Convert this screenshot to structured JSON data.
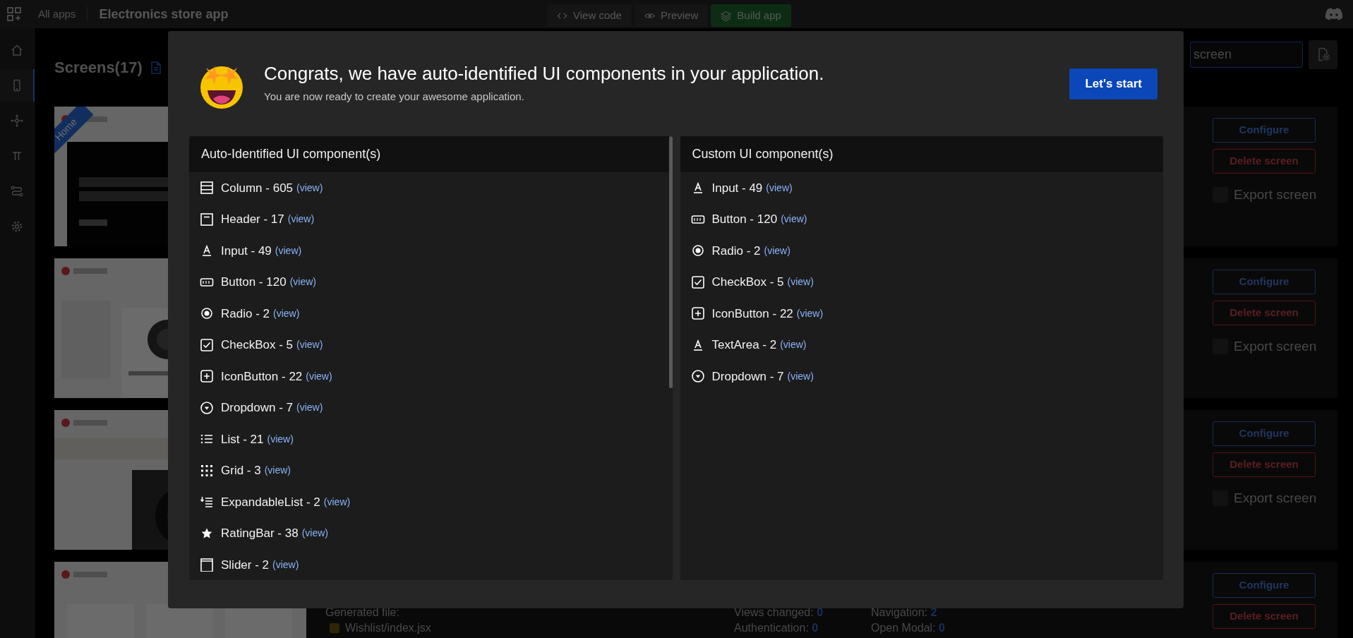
{
  "top_bar": {
    "apps_label": "All apps",
    "title": "Electronics store app",
    "buttons": [
      {
        "kind": "code",
        "label": "View code"
      },
      {
        "kind": "eye",
        "label": "Preview"
      },
      {
        "kind": "build",
        "label": "Build app"
      }
    ]
  },
  "sidebar": {
    "items": [
      {
        "kind": "home",
        "selected": false
      },
      {
        "kind": "phone",
        "selected": true
      },
      {
        "kind": "nodes",
        "selected": false
      },
      {
        "kind": "pi",
        "selected": false
      },
      {
        "kind": "route",
        "selected": false
      },
      {
        "kind": "gear",
        "selected": false
      }
    ]
  },
  "screens": {
    "title": "Screens(17)",
    "search": {
      "placeholder": "screen"
    },
    "cards": [
      {
        "ribbon": "Home",
        "buttons": [
          "Configure",
          "Delete screen"
        ],
        "export": {
          "label": "Export screen",
          "checked": false
        }
      },
      {
        "buttons": [
          "Configure",
          "Delete screen"
        ],
        "export": {
          "label": "Export screen",
          "checked": false
        }
      },
      {
        "buttons": [
          "Configure",
          "Delete screen"
        ],
        "export": {
          "label": "Export screen",
          "checked": false
        }
      },
      {
        "buttons": [
          "Configure",
          "Delete screen"
        ],
        "generated": {
          "label": "Generated file:",
          "files": [
            "Wishlist/index.jsx"
          ]
        },
        "stats": [
          {
            "label": "Views changed:",
            "value": "0"
          },
          {
            "label": "Navigation:",
            "value": "2"
          },
          {
            "label": "Authentication:",
            "value": "0"
          },
          {
            "label": "Open Modal:",
            "value": "0"
          }
        ]
      }
    ]
  },
  "modal": {
    "title": "Congrats, we have auto-identified UI components in your application.",
    "subtitle": "You are now ready to create your awesome application.",
    "start_button": "Let's start",
    "panels": [
      {
        "title": "Auto-Identified UI component(s)",
        "items": [
          {
            "kind": "column",
            "label": "Column - 605",
            "link": "(view)"
          },
          {
            "kind": "header",
            "label": "Header - 17",
            "link": "(view)"
          },
          {
            "kind": "input",
            "label": "Input - 49",
            "link": "(view)"
          },
          {
            "kind": "button",
            "label": "Button - 120",
            "link": "(view)"
          },
          {
            "kind": "radio",
            "label": "Radio - 2",
            "link": "(view)"
          },
          {
            "kind": "checkbox",
            "label": "CheckBox - 5",
            "link": "(view)"
          },
          {
            "kind": "iconbutton",
            "label": "IconButton - 22",
            "link": "(view)"
          },
          {
            "kind": "dropdown",
            "label": "Dropdown - 7",
            "link": "(view)"
          },
          {
            "kind": "list",
            "label": "List - 21",
            "link": "(view)"
          },
          {
            "kind": "grid",
            "label": "Grid - 3",
            "link": "(view)"
          },
          {
            "kind": "expandable",
            "label": "ExpandableList - 2",
            "link": "(view)"
          },
          {
            "kind": "rating",
            "label": "RatingBar - 38",
            "link": "(view)"
          },
          {
            "kind": "slider",
            "label": "Slider - 2",
            "link": "(view)"
          }
        ]
      },
      {
        "title": "Custom UI component(s)",
        "items": [
          {
            "kind": "input",
            "label": "Input - 49",
            "link": "(view)"
          },
          {
            "kind": "button",
            "label": "Button - 120",
            "link": "(view)"
          },
          {
            "kind": "radio",
            "label": "Radio - 2",
            "link": "(view)"
          },
          {
            "kind": "checkbox",
            "label": "CheckBox - 5",
            "link": "(view)"
          },
          {
            "kind": "iconbutton",
            "label": "IconButton - 22",
            "link": "(view)"
          },
          {
            "kind": "input",
            "label": "TextArea - 2",
            "link": "(view)"
          },
          {
            "kind": "dropdown",
            "label": "Dropdown - 7",
            "link": "(view)"
          }
        ]
      }
    ]
  }
}
